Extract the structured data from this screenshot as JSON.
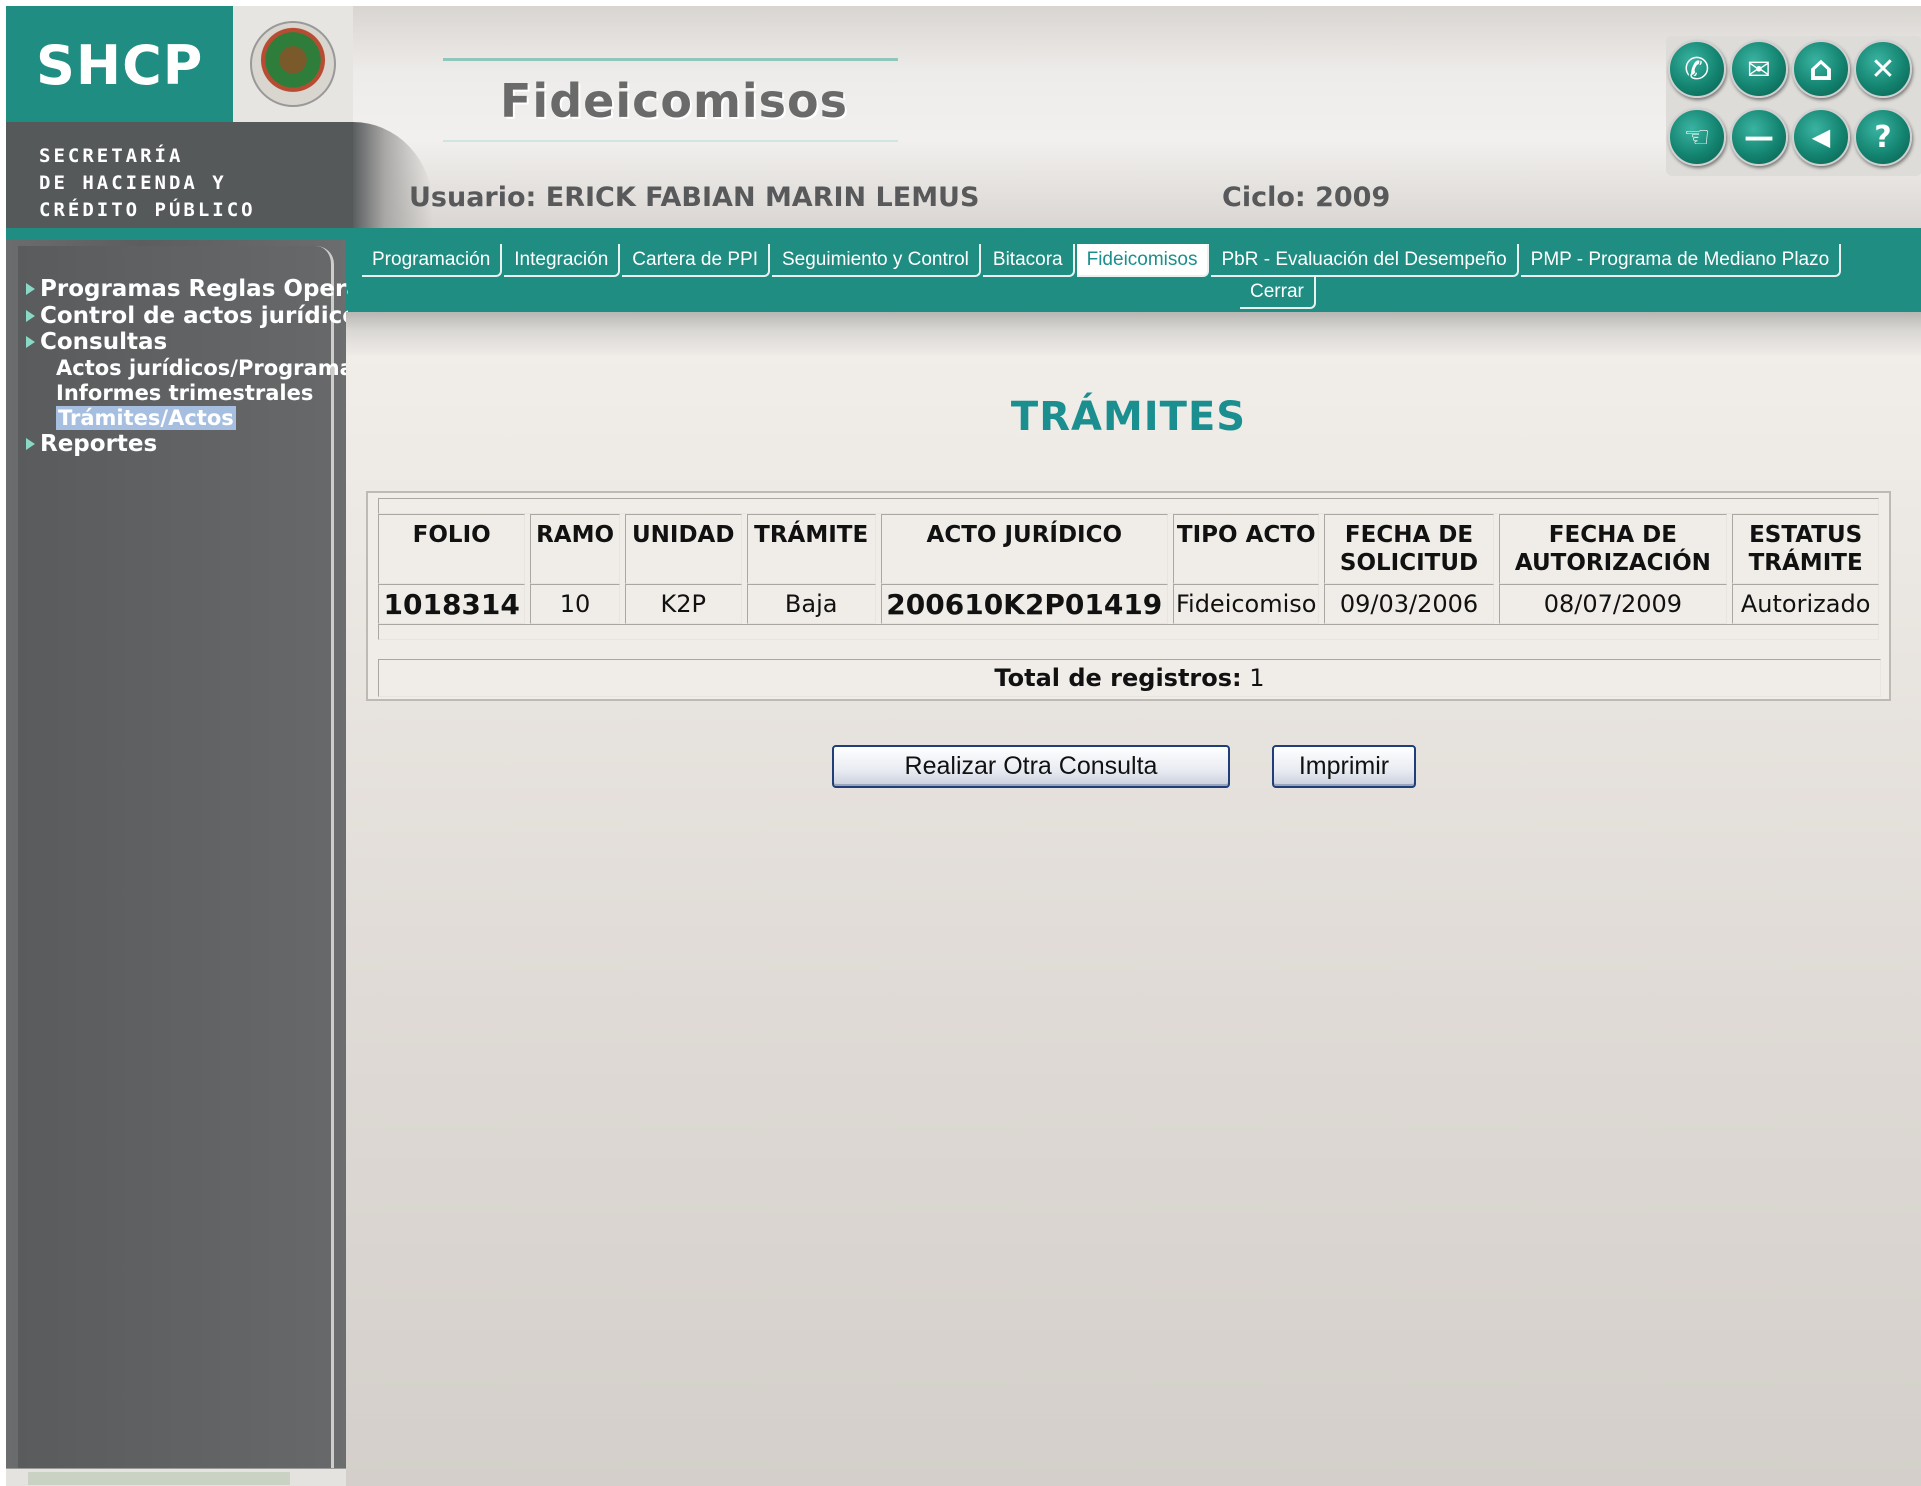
{
  "header": {
    "logo_main": "SHCP",
    "logo_lines": [
      "SECRETARÍA",
      "DE HACIENDA Y",
      "CRÉDITO PÚBLICO"
    ],
    "app_title": "Fideicomisos",
    "user_label": "Usuario:",
    "user_name": "ERICK FABIAN MARIN LEMUS",
    "cycle_label": "Ciclo:",
    "cycle_value": "2009",
    "toolbar": {
      "phone_icon": "✆",
      "mail_icon": "✉",
      "home_icon": "⌂",
      "close_icon": "✕",
      "pointer_icon": "☜",
      "minus_icon": "—",
      "back_icon": "◀",
      "help_icon": "?"
    }
  },
  "nav": {
    "tabs": [
      "Programación",
      "Integración",
      "Cartera de PPI",
      "Seguimiento y Control",
      "Bitacora",
      "Fideicomisos",
      "PbR - Evaluación del Desempeño",
      "PMP - Programa de Mediano Plazo"
    ],
    "active_tab": "Fideicomisos",
    "close_tab": "Cerrar"
  },
  "sidebar": {
    "items": [
      {
        "label": "Programas Reglas Operación"
      },
      {
        "label": "Control de actos jurídicos"
      },
      {
        "label": "Consultas"
      }
    ],
    "subitems": [
      "Actos jurídicos/Programas",
      "Informes trimestrales",
      "Trámites/Actos"
    ],
    "selected_subitem": "Trámites/Actos",
    "last_item": "Reportes"
  },
  "main": {
    "title": "TRÁMITES",
    "table": {
      "headers": [
        "FOLIO",
        "RAMO",
        "UNIDAD",
        "TRÁMITE",
        "ACTO JURÍDICO",
        "TIPO ACTO",
        "FECHA DE SOLICITUD",
        "FECHA DE AUTORIZACIÓN",
        "ESTATUS TRÁMITE"
      ],
      "rows": [
        [
          "1018314",
          "10",
          "K2P",
          "Baja",
          "200610K2P01419",
          "Fideicomiso",
          "09/03/2006",
          "08/07/2009",
          "Autorizado"
        ]
      ]
    },
    "total_label": "Total de registros:",
    "total_value": "1",
    "buttons": {
      "other_query": "Realizar Otra Consulta",
      "print": "Imprimir"
    }
  }
}
